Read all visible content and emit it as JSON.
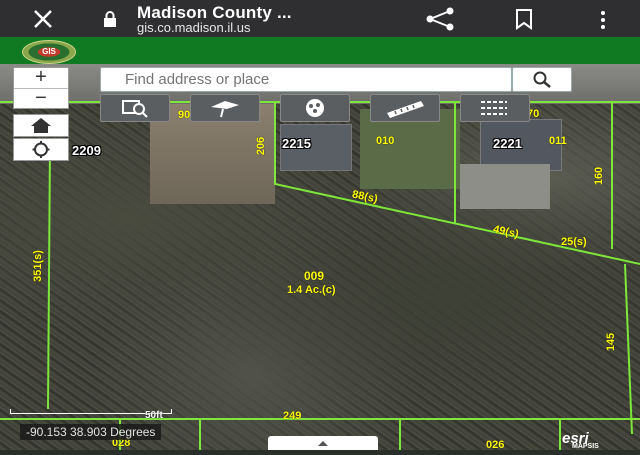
{
  "browser": {
    "title": "Madison County ...",
    "url": "gis.co.madison.il.us"
  },
  "app": {
    "logo_text": "GIS",
    "toolbar": [
      "layer-list-icon",
      "layers-icon",
      "basemap-gallery-icon",
      "print-icon"
    ]
  },
  "search": {
    "placeholder": "Find address or place"
  },
  "zoom": {
    "in": "+",
    "out": "−"
  },
  "tools": [
    "identify-icon",
    "measure-area-icon",
    "select-icon",
    "measure-icon",
    "legend-icon"
  ],
  "map": {
    "house_numbers": [
      "2209",
      "2215",
      "2221"
    ],
    "parcels": [
      "009",
      "010",
      "011",
      "028",
      "026"
    ],
    "dimension_labels": [
      "1.4 Ac.(c)",
      "88(s)",
      "49(s)",
      "25(s)",
      "351(s)",
      "160",
      "145",
      "249",
      "70",
      "206",
      "90"
    ],
    "coordinates": "-90.153 38.903 Degrees",
    "scale_label": "50ft",
    "attribution": "esri",
    "attribution_small": "MAPSIS"
  },
  "colors": {
    "appbar": "#0f7a22",
    "topbar": "#2f2f31",
    "parcel_line": "#7ee73a",
    "label": "#ffff00"
  }
}
